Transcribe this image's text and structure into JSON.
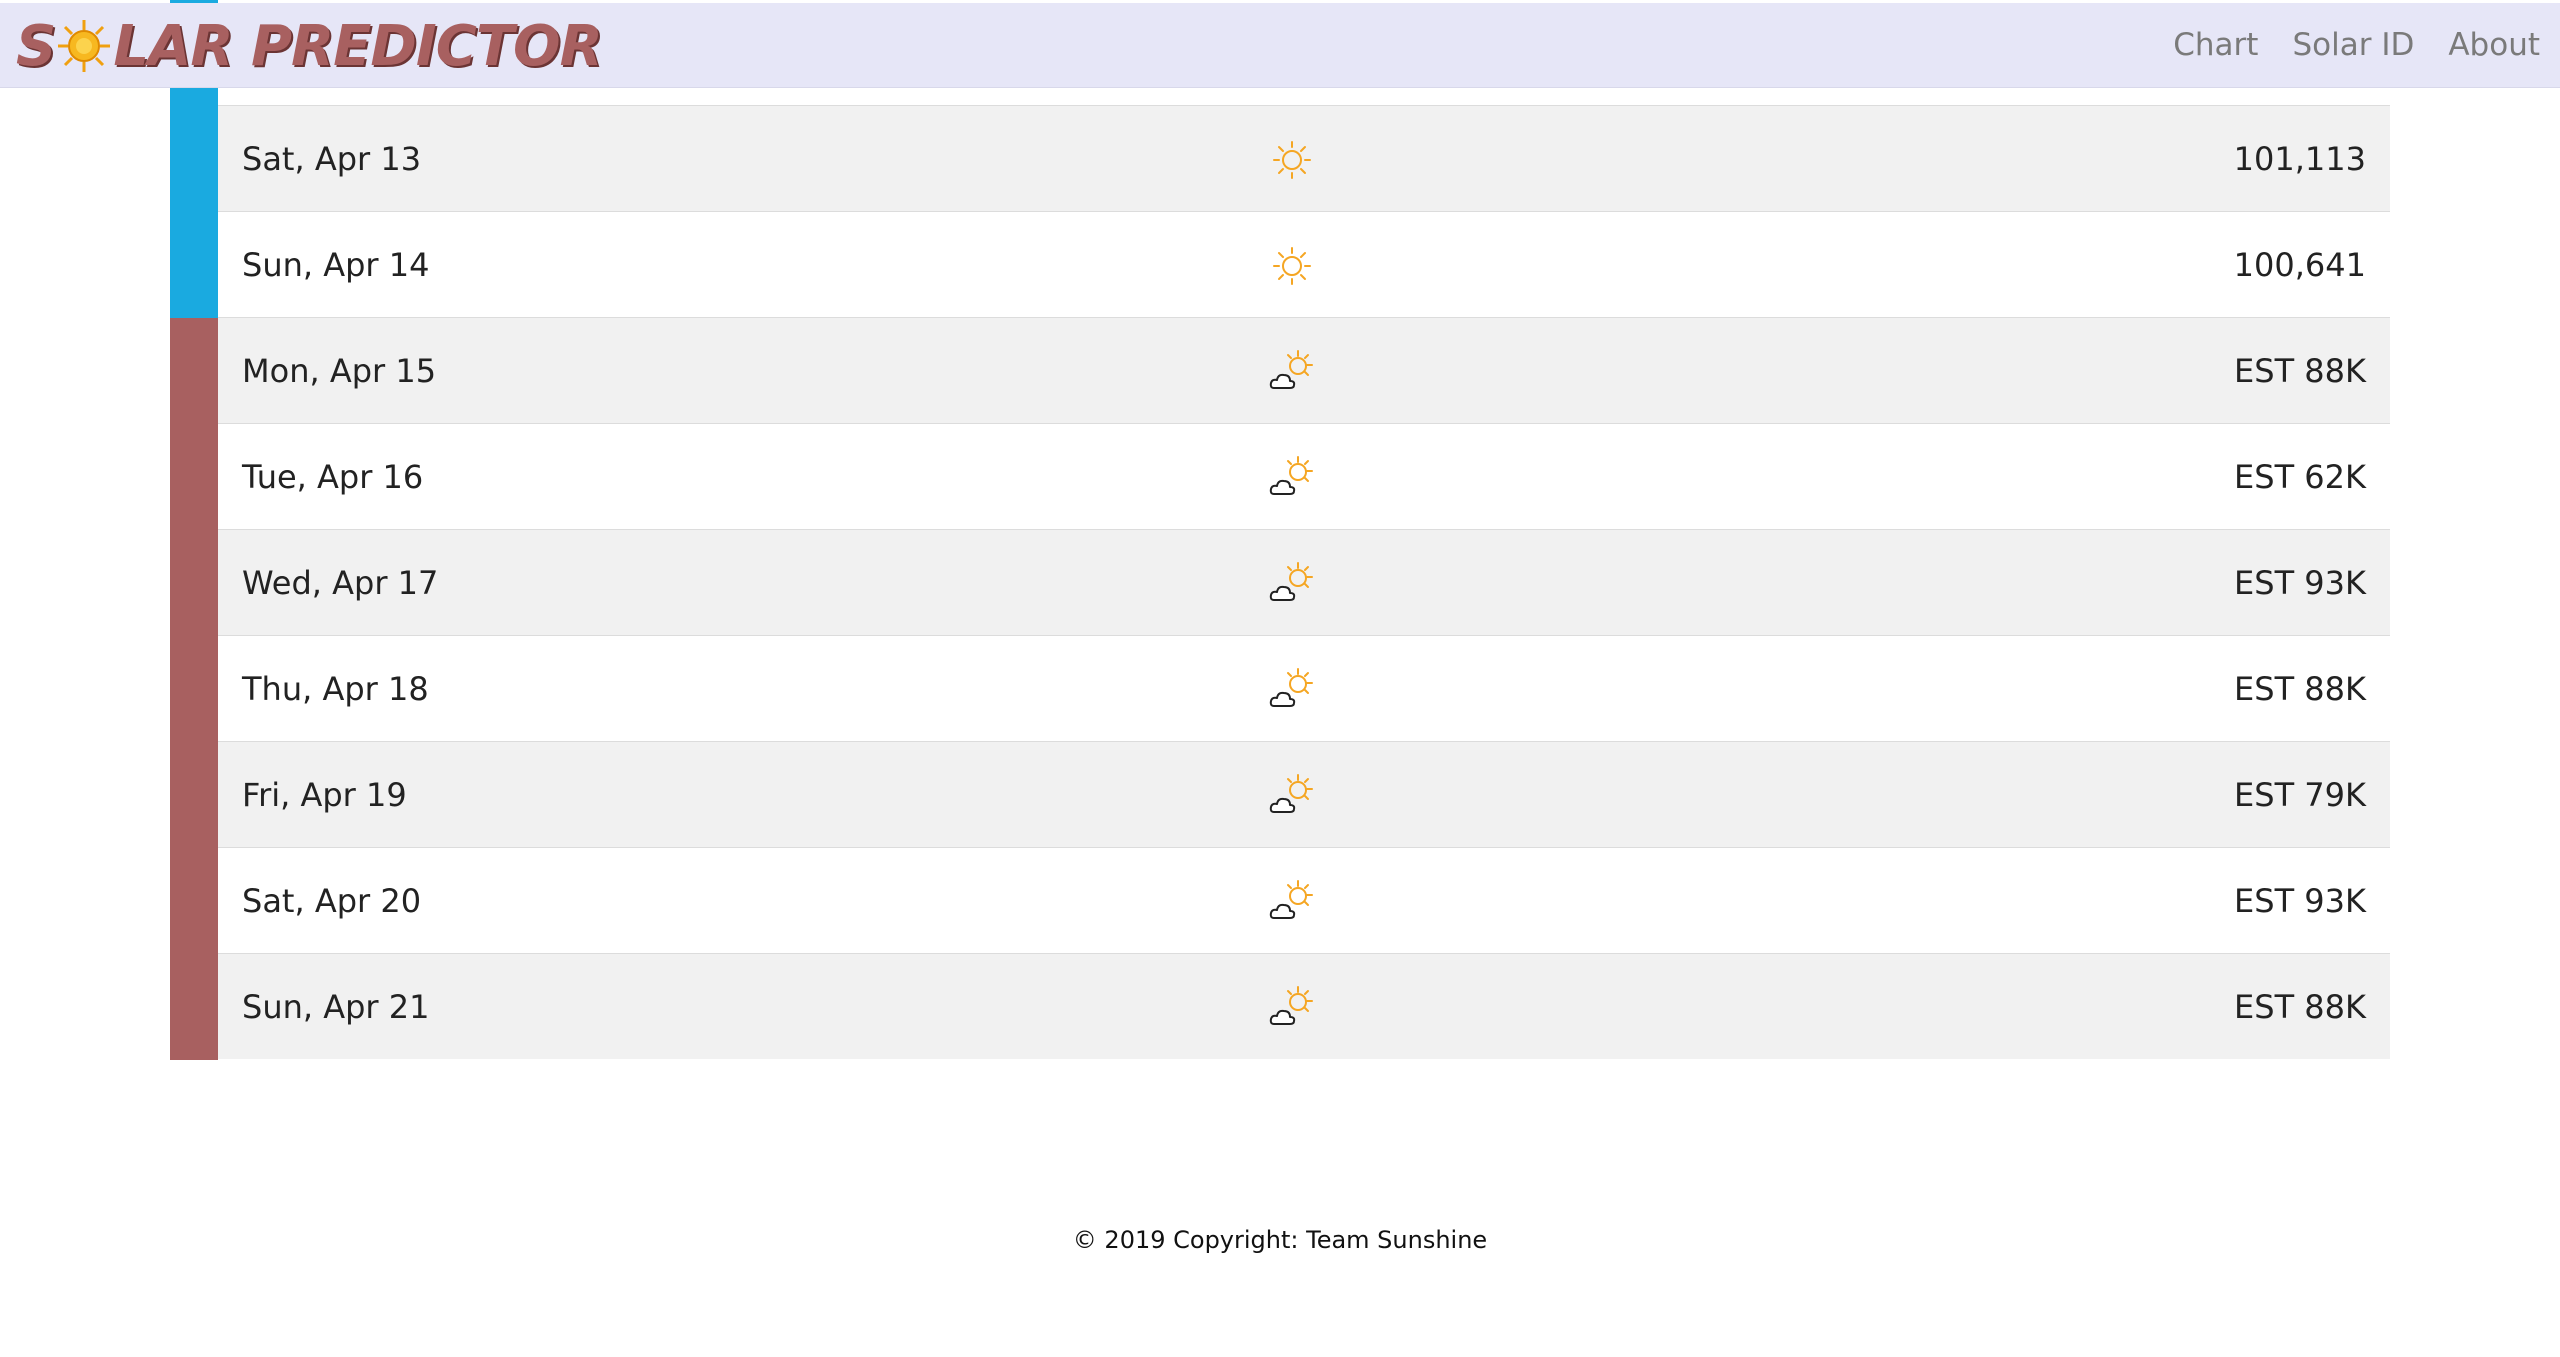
{
  "app": {
    "logo_text_pre": "S",
    "logo_text_post": "LAR PREDICTOR"
  },
  "nav": {
    "items": [
      {
        "label": "Chart"
      },
      {
        "label": "Solar ID"
      },
      {
        "label": "About"
      }
    ]
  },
  "colors": {
    "actual": "#1aaae0",
    "estimate": "#a86060",
    "navbar": "#e6e6f7",
    "sun": "#f5a623"
  },
  "forecast": {
    "rows": [
      {
        "date": "",
        "icon": "partly-cloudy-icon",
        "value": "",
        "type": "actual"
      },
      {
        "date": "Sat, Apr 13",
        "icon": "sunny-icon",
        "value": "101,113",
        "type": "actual"
      },
      {
        "date": "Sun, Apr 14",
        "icon": "sunny-icon",
        "value": "100,641",
        "type": "actual"
      },
      {
        "date": "Mon, Apr 15",
        "icon": "partly-cloudy-icon",
        "value": "EST 88K",
        "type": "estimate"
      },
      {
        "date": "Tue, Apr 16",
        "icon": "partly-cloudy-icon",
        "value": "EST 62K",
        "type": "estimate"
      },
      {
        "date": "Wed, Apr 17",
        "icon": "partly-cloudy-icon",
        "value": "EST 93K",
        "type": "estimate"
      },
      {
        "date": "Thu, Apr 18",
        "icon": "partly-cloudy-icon",
        "value": "EST 88K",
        "type": "estimate"
      },
      {
        "date": "Fri, Apr 19",
        "icon": "partly-cloudy-icon",
        "value": "EST 79K",
        "type": "estimate"
      },
      {
        "date": "Sat, Apr 20",
        "icon": "partly-cloudy-icon",
        "value": "EST 93K",
        "type": "estimate"
      },
      {
        "date": "Sun, Apr 21",
        "icon": "partly-cloudy-icon",
        "value": "EST 88K",
        "type": "estimate"
      }
    ]
  },
  "footer": {
    "text": "© 2019 Copyright: Team Sunshine"
  }
}
